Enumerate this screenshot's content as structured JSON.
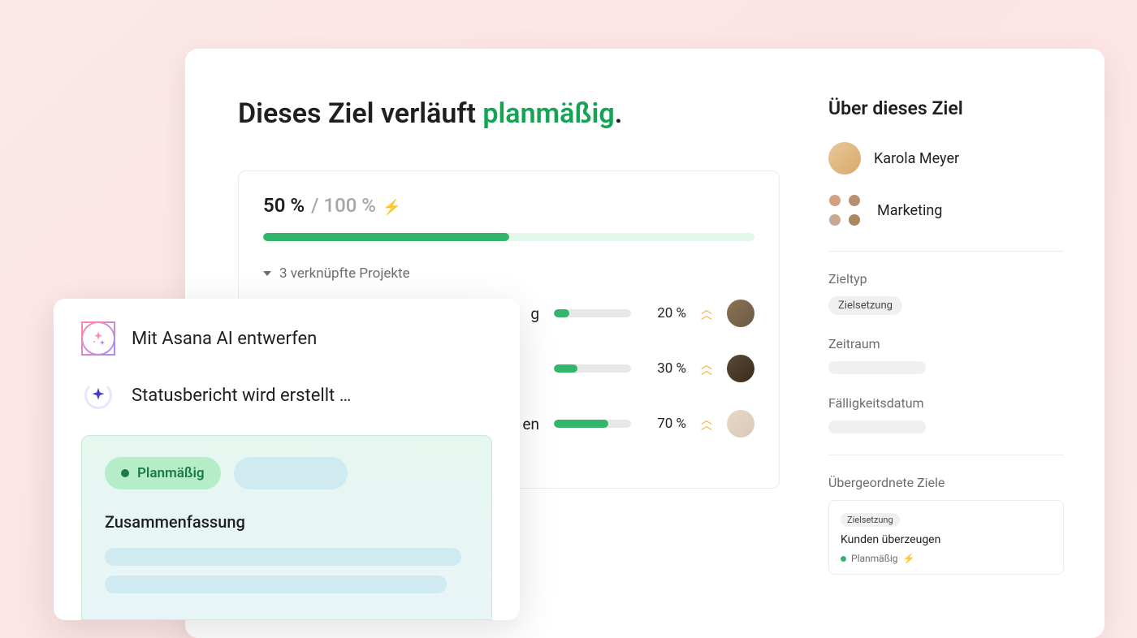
{
  "headline": {
    "prefix": "Dieses Ziel verläuft ",
    "status": "planmäßig",
    "suffix": "."
  },
  "progress": {
    "current": "50 %",
    "total": "/ 100 %",
    "percent": 50,
    "linked_label": "3 verknüpfte Projekte"
  },
  "projects": [
    {
      "name_suffix": "g",
      "percent": 20,
      "pct_label": "20 %"
    },
    {
      "name_suffix": "",
      "percent": 30,
      "pct_label": "30 %"
    },
    {
      "name_suffix": "en",
      "percent": 70,
      "pct_label": "70 %"
    }
  ],
  "sidebar": {
    "title": "Über dieses Ziel",
    "owner": "Karola Meyer",
    "team": "Marketing",
    "goal_type_label": "Zieltyp",
    "goal_type_value": "Zielsetzung",
    "period_label": "Zeitraum",
    "due_label": "Fälligkeitsdatum",
    "parent_label": "Übergeordnete Ziele",
    "parent_goal": {
      "type": "Zielsetzung",
      "title": "Kunden überzeugen",
      "status": "Planmäßig"
    }
  },
  "ai": {
    "draft_title": "Mit Asana AI entwerfen",
    "generating": "Statusbericht wird erstellt …",
    "on_track_chip": "Planmäßig",
    "summary_title": "Zusammenfassung"
  },
  "colors": {
    "green": "#32b66b",
    "text": "#1e1f21"
  }
}
